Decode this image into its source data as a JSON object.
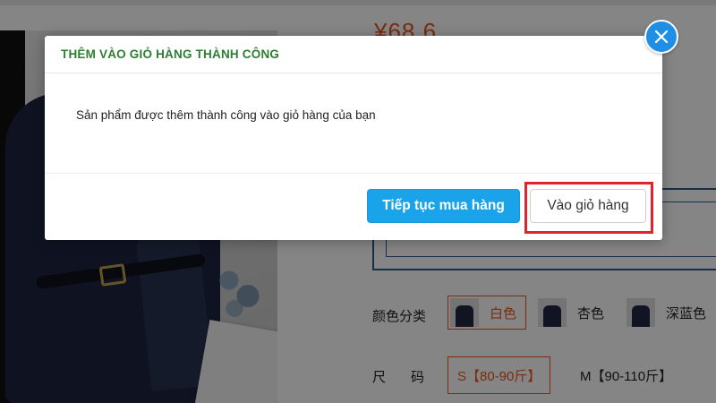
{
  "product": {
    "price": "¥68.6",
    "color_label": "颜色分类",
    "colors": [
      "白色",
      "杏色",
      "深蓝色"
    ],
    "size_label": "尺码",
    "sizes": [
      "S【80-90斤】",
      "M【90-110斤】"
    ]
  },
  "dialog": {
    "title": "THÊM VÀO GIỎ HÀNG THÀNH CÔNG",
    "message": "Sản phẩm được thêm thành công vào giỏ hàng của bạn",
    "continue_label": "Tiếp tục mua hàng",
    "cart_label": "Vào giỏ hàng",
    "close_icon": "close-icon"
  },
  "colors": {
    "accent_blue": "#1aa3e8",
    "title_green": "#2e7d32",
    "highlight_red": "#e0232d",
    "price_orange": "#e8551c"
  }
}
